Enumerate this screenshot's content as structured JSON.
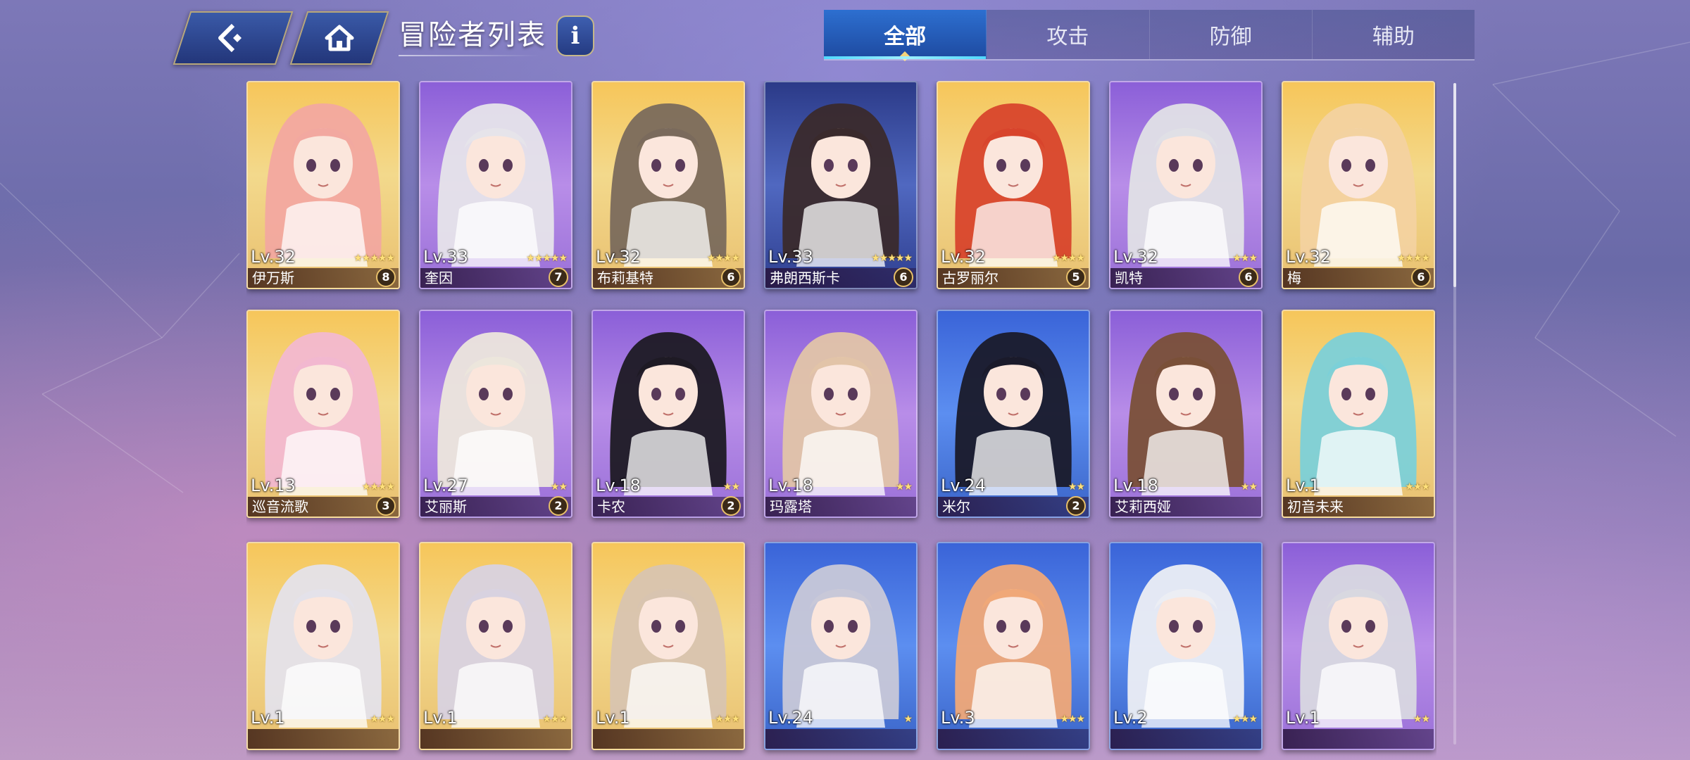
{
  "header": {
    "title": "冒险者列表",
    "back_icon": "back-arrow-icon",
    "home_icon": "home-icon",
    "info_label": "i"
  },
  "tabs": [
    {
      "label": "全部",
      "active": true
    },
    {
      "label": "攻击",
      "active": false
    },
    {
      "label": "防御",
      "active": false
    },
    {
      "label": "辅助",
      "active": false
    }
  ],
  "cards": [
    {
      "level": "Lv.32",
      "name": "伊万斯",
      "stars": 5,
      "badge": "8",
      "frame": "gold",
      "hair": "#f2a8a0"
    },
    {
      "level": "Lv.33",
      "name": "奎因",
      "stars": 5,
      "badge": "7",
      "frame": "purple",
      "hair": "#e6e4ea"
    },
    {
      "level": "Lv.32",
      "name": "布莉基特",
      "stars": 4,
      "badge": "6",
      "frame": "gold",
      "hair": "#7a6a5c"
    },
    {
      "level": "Lv.33",
      "name": "弗朗西斯卡",
      "stars": 5,
      "badge": "6",
      "frame": "navy",
      "hair": "#3a2a2c"
    },
    {
      "level": "Lv.32",
      "name": "古罗丽尔",
      "stars": 4,
      "badge": "5",
      "frame": "gold",
      "hair": "#d8442c"
    },
    {
      "level": "Lv.32",
      "name": "凯特",
      "stars": 3,
      "badge": "6",
      "frame": "purple",
      "hair": "#e0e0e6"
    },
    {
      "level": "Lv.32",
      "name": "梅",
      "stars": 4,
      "badge": "6",
      "frame": "gold",
      "hair": "#f3d2a0"
    },
    {
      "level": "Lv.13",
      "name": "巡音流歌",
      "stars": 4,
      "badge": "3",
      "frame": "gold",
      "hair": "#f2b8d0"
    },
    {
      "level": "Lv.27",
      "name": "艾丽斯",
      "stars": 2,
      "badge": "2",
      "frame": "purple",
      "hair": "#ece6dc"
    },
    {
      "level": "Lv.18",
      "name": "卡农",
      "stars": 2,
      "badge": "2",
      "frame": "purple",
      "hair": "#1e1a24"
    },
    {
      "level": "Lv.18",
      "name": "玛露塔",
      "stars": 2,
      "badge": "",
      "frame": "purple",
      "hair": "#e2c4a8"
    },
    {
      "level": "Lv.24",
      "name": "米尔",
      "stars": 2,
      "badge": "2",
      "frame": "blue",
      "hair": "#1a1a2a"
    },
    {
      "level": "Lv.18",
      "name": "艾莉西娅",
      "stars": 2,
      "badge": "",
      "frame": "purple",
      "hair": "#7a5038"
    },
    {
      "level": "Lv.1",
      "name": "初音未来",
      "stars": 3,
      "badge": "",
      "frame": "gold",
      "hair": "#7cd0d8"
    },
    {
      "level": "Lv.1",
      "name": "",
      "stars": 3,
      "badge": "",
      "frame": "gold",
      "hair": "#e4e2ea"
    },
    {
      "level": "Lv.1",
      "name": "",
      "stars": 3,
      "badge": "",
      "frame": "gold",
      "hair": "#d8d2e0"
    },
    {
      "level": "Lv.1",
      "name": "",
      "stars": 3,
      "badge": "",
      "frame": "gold",
      "hair": "#d8c4b0"
    },
    {
      "level": "Lv.24",
      "name": "",
      "stars": 1,
      "badge": "",
      "frame": "blue",
      "hair": "#c8c8d8"
    },
    {
      "level": "Lv.3",
      "name": "",
      "stars": 3,
      "badge": "",
      "frame": "blue",
      "hair": "#f0a878"
    },
    {
      "level": "Lv.2",
      "name": "",
      "stars": 3,
      "badge": "",
      "frame": "blue",
      "hair": "#eceef4"
    },
    {
      "level": "Lv.1",
      "name": "",
      "stars": 2,
      "badge": "",
      "frame": "purple",
      "hair": "#d8d8e0"
    }
  ],
  "colors": {
    "tab_active": "#2d6fd0",
    "tab_indicator": "#4fd8ff",
    "button_border": "#b7a77a",
    "star": "#ffe07a"
  }
}
